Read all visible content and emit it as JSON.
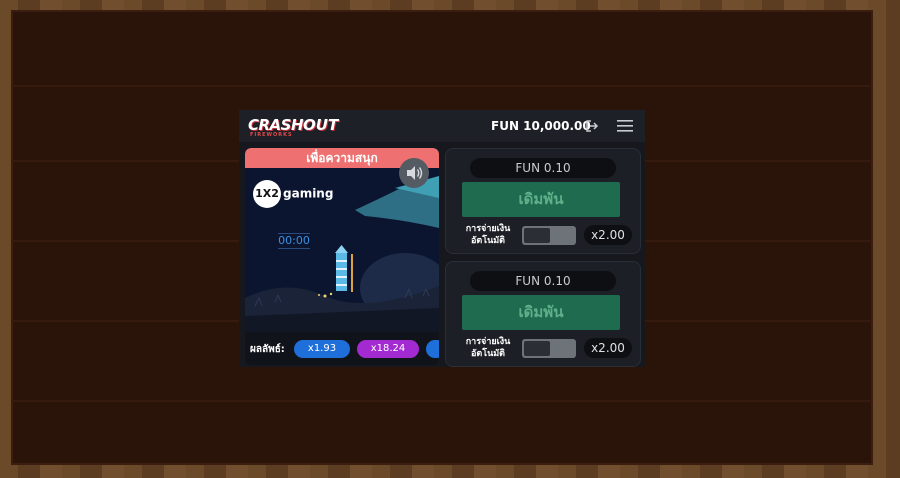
{
  "app": {
    "logo_main": "CRASH",
    "logo_second": "OUT",
    "logo_sub": "FIREWORKS"
  },
  "header": {
    "balance": "FUN 10,000.00",
    "exit_icon": "logout-icon",
    "menu_icon": "hamburger-menu-icon"
  },
  "game_view": {
    "banner": "เพื่อความสนุก",
    "brand": "gaming",
    "brand_badge": "1X2",
    "timer": "00:00",
    "sound_icon": "speaker-icon"
  },
  "results": {
    "label": "ผลลัพธ์:",
    "items": [
      {
        "value": "x1.93",
        "color": "#1e6fd9"
      },
      {
        "value": "x18.24",
        "color": "#a32ad1"
      }
    ]
  },
  "bets": [
    {
      "amount": "FUN 0.10",
      "button": "เดิมพัน",
      "auto_label_1": "การจ่ายเงิน",
      "auto_label_2": "อัตโนมัติ",
      "auto_on": false,
      "multiplier": "x2.00"
    },
    {
      "amount": "FUN 0.10",
      "button": "เดิมพัน",
      "auto_label_1": "การจ่ายเงิน",
      "auto_label_2": "อัตโนมัติ",
      "auto_on": false,
      "multiplier": "x2.00"
    }
  ],
  "colors": {
    "banner": "#ef7070",
    "bet_button": "#1f6b4f",
    "accent_blue": "#1e6fd9",
    "accent_purple": "#a32ad1"
  }
}
